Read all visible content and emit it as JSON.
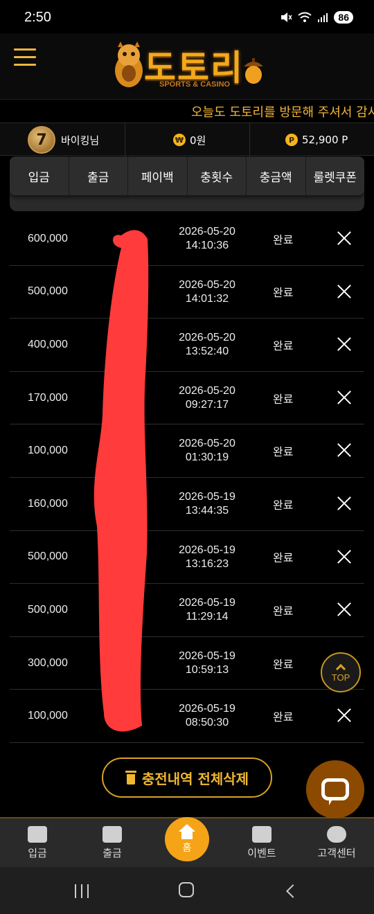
{
  "status_bar": {
    "time": "2:50",
    "battery": "86"
  },
  "header": {
    "logo_text": "도토리",
    "logo_subtitle": "SPORTS & CASINO"
  },
  "marquee": {
    "text": "오늘도 도토리를 방문해 주셔서 감사"
  },
  "user": {
    "level": "7",
    "name": "바이킹님",
    "cash": "0원",
    "points": "52,900 P"
  },
  "tabs": [
    "입금",
    "출금",
    "페이백",
    "충횟수",
    "충금액",
    "룰렛쿠폰"
  ],
  "deposits": [
    {
      "amount": "600,000",
      "date": "2026-05-20",
      "time": "14:10:36",
      "status": "완료"
    },
    {
      "amount": "500,000",
      "date": "2026-05-20",
      "time": "14:01:32",
      "status": "완료"
    },
    {
      "amount": "400,000",
      "date": "2026-05-20",
      "time": "13:52:40",
      "status": "완료"
    },
    {
      "amount": "170,000",
      "date": "2026-05-20",
      "time": "09:27:17",
      "status": "완료"
    },
    {
      "amount": "100,000",
      "date": "2026-05-20",
      "time": "01:30:19",
      "status": "완료"
    },
    {
      "amount": "160,000",
      "date": "2026-05-19",
      "time": "13:44:35",
      "status": "완료"
    },
    {
      "amount": "500,000",
      "date": "2026-05-19",
      "time": "13:16:23",
      "status": "완료"
    },
    {
      "amount": "500,000",
      "date": "2026-05-19",
      "time": "11:29:14",
      "status": "완료"
    },
    {
      "amount": "300,000",
      "date": "2026-05-19",
      "time": "10:59:13",
      "status": "완료"
    },
    {
      "amount": "100,000",
      "date": "2026-05-19",
      "time": "08:50:30",
      "status": "완료"
    }
  ],
  "top_button": "TOP",
  "delete_all_label": "충전내역 전체삭제",
  "bottom_nav": {
    "items": [
      {
        "label": "입금",
        "icon": "deposit-card-icon"
      },
      {
        "label": "출금",
        "icon": "withdraw-icon"
      },
      {
        "label": "홈",
        "icon": "home-icon"
      },
      {
        "label": "이벤트",
        "icon": "gift-icon"
      },
      {
        "label": "고객센터",
        "icon": "chat-bubbles-icon"
      }
    ]
  },
  "colors": {
    "accent": "#f4a416",
    "background": "#000000",
    "redaction": "#ff3b3b"
  }
}
